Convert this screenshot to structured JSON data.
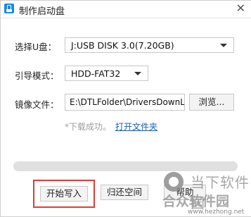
{
  "window": {
    "title": "制作启动盘"
  },
  "form": {
    "usb_label": "选择U盘：",
    "usb_value": "J:USB DISK 3.0(7.20GB)",
    "mode_label": "引导模式：",
    "mode_value": "HDD-FAT32",
    "image_label": "镜像文件：",
    "image_path": "E:\\DTLFolder\\DriversDownLc",
    "browse_label": "浏览..."
  },
  "status": {
    "message": "*下载成功。",
    "link": "打开文件夹"
  },
  "progress": {
    "value": 0
  },
  "buttons": {
    "start": "开始写入",
    "restore": "归还空间",
    "help": "帮助"
  },
  "watermark": {
    "top": "当下软件园",
    "main": "合众软件园",
    "url": "www.hezhong.net"
  }
}
